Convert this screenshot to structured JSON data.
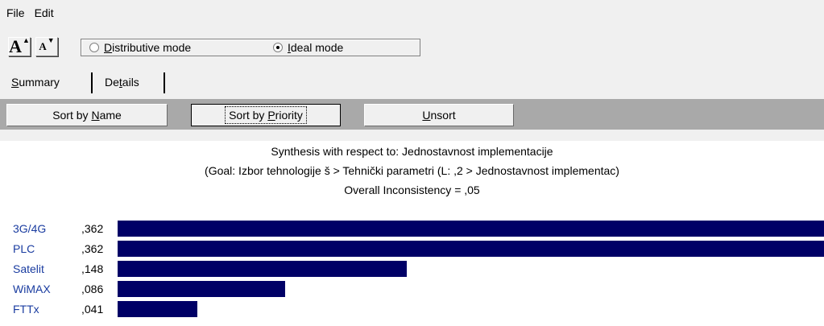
{
  "menu": {
    "file": "File",
    "edit": "Edit"
  },
  "toolbar": {
    "font_larger": "A",
    "font_smaller": "A",
    "mode": {
      "distributive_underline": "D",
      "distributive_rest": "istributive mode",
      "ideal_underline": "I",
      "ideal_rest": "deal mode",
      "selected": "Ideal mode"
    }
  },
  "tabs": {
    "summary_underline": "S",
    "summary_rest": "ummary",
    "details_pre": "De",
    "details_underline": "t",
    "details_rest": "ails"
  },
  "sort": {
    "by_name_pre": "Sort by ",
    "by_name_underline": "N",
    "by_name_rest": "ame",
    "by_priority_pre": "Sort by ",
    "by_priority_underline": "P",
    "by_priority_rest": "riority",
    "unsort_underline": "U",
    "unsort_rest": "nsort"
  },
  "synthesis": {
    "line1": "Synthesis with respect to: Jednostavnost implementacije",
    "line2": "(Goal: Izbor tehnologije š > Tehnički parametri (L: ,2 > Jednostavnost implementac)",
    "line3": "Overall Inconsistency = ,05"
  },
  "colors": {
    "bar": "#000066",
    "label": "#1a3ca0",
    "sortbar": "#a9a9a9"
  },
  "chart_data": {
    "type": "bar",
    "categories": [
      "3G/4G",
      "PLC",
      "Satelit",
      "WiMAX",
      "FTTx"
    ],
    "values": [
      0.362,
      0.362,
      0.148,
      0.086,
      0.041
    ],
    "value_labels": [
      ",362",
      ",362",
      ",148",
      ",086",
      ",041"
    ],
    "max": 0.362
  }
}
